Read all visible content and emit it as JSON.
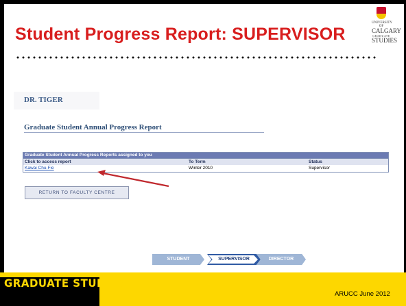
{
  "slide": {
    "title": "Student Progress Report: SUPERVISOR",
    "logo": {
      "line1": "UNIVERSITY OF",
      "line2": "CALGARY",
      "line3": "GRADUATE",
      "line4": "STUDIES"
    }
  },
  "app": {
    "user_name": "DR. TIGER",
    "page_title": "Graduate Student Annual Progress Report",
    "grid": {
      "caption": "Graduate Student Annual Progress Reports assigned to you",
      "columns": [
        "Click to access report",
        "To Term",
        "Status"
      ],
      "rows": [
        {
          "student": "Kawai Chu-Fie",
          "term": "Winter 2010",
          "status": "Supervisor"
        }
      ]
    },
    "return_button": "RETURN TO FACULTY CENTRE"
  },
  "workflow": {
    "steps": [
      "STUDENT",
      "SUPERVISOR",
      "DIRECTOR"
    ],
    "current": "SUPERVISOR"
  },
  "footer": {
    "brand": "GRADUATE STUDIES",
    "date": "ARUCC June 2012"
  },
  "colors": {
    "title_red": "#d81e1e",
    "footer_yellow": "#fdd700",
    "grid_header": "#6c7bb3",
    "arrow": "#c0282d"
  }
}
